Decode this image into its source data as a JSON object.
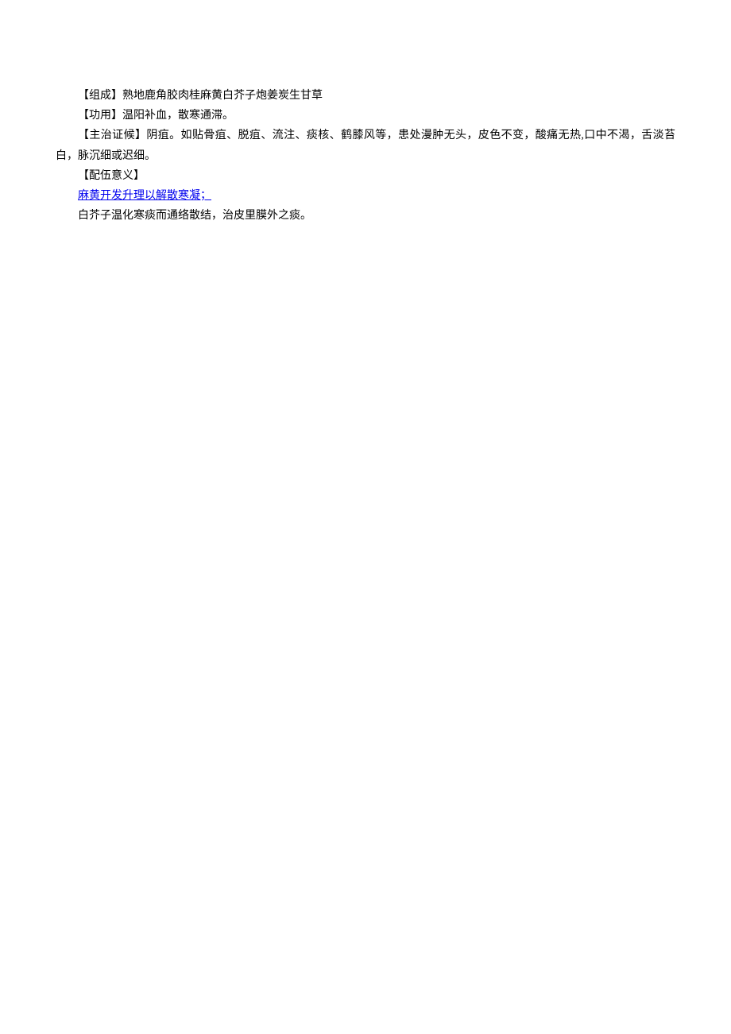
{
  "document": {
    "lines": [
      {
        "label": "【组成】",
        "content": "熟地鹿角胶肉桂麻黄白芥子炮姜炭生甘草",
        "type": "normal"
      },
      {
        "label": "【功用】",
        "content": "温阳补血，散寒通滞。",
        "type": "normal"
      },
      {
        "label": "【主治证候】",
        "content": "阴疽。如贴骨疽、脱疽、流注、痰核、鹤膝风等，患处漫肿无头，皮色不变，酸痛无热,口中不渴，舌淡苔白，脉沉细或迟细。",
        "type": "normal"
      },
      {
        "label": "【配伍意义】",
        "content": "",
        "type": "normal"
      },
      {
        "label": "",
        "content": "麻黄开发升理以解散寒凝；",
        "type": "link"
      },
      {
        "label": "",
        "content": "白芥子温化寒痰而通络散结，治皮里膜外之痰。",
        "type": "normal"
      }
    ]
  }
}
